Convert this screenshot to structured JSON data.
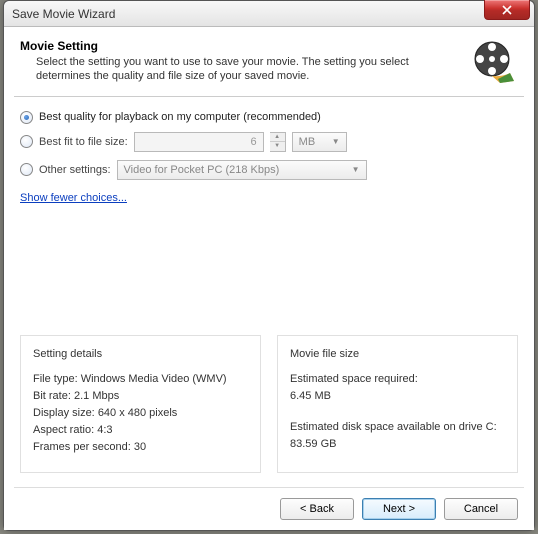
{
  "window": {
    "title": "Save Movie Wizard"
  },
  "header": {
    "title": "Movie Setting",
    "subtitle": "Select the setting you want to use to save your movie. The setting you select determines the quality and file size of your saved movie."
  },
  "options": {
    "best_quality": "Best quality for playback on my computer (recommended)",
    "best_fit": "Best fit to file size:",
    "best_fit_value": "6",
    "best_fit_unit": "MB",
    "other": "Other settings:",
    "other_value": "Video for Pocket PC (218 Kbps)",
    "link": "Show fewer choices..."
  },
  "details": {
    "heading": "Setting details",
    "file_type_label": "File type:",
    "file_type": "Windows Media Video (WMV)",
    "bit_rate_label": "Bit rate:",
    "bit_rate": "2.1 Mbps",
    "display_size_label": "Display size:",
    "display_size": "640 x 480 pixels",
    "aspect_label": "Aspect ratio:",
    "aspect": "4:3",
    "fps_label": "Frames per second:",
    "fps": "30"
  },
  "filesize": {
    "heading": "Movie file size",
    "req_label": "Estimated space required:",
    "req_value": "6.45 MB",
    "avail_label": "Estimated disk space available on drive C:",
    "avail_value": "83.59 GB"
  },
  "buttons": {
    "back": "< Back",
    "next": "Next >",
    "cancel": "Cancel"
  }
}
